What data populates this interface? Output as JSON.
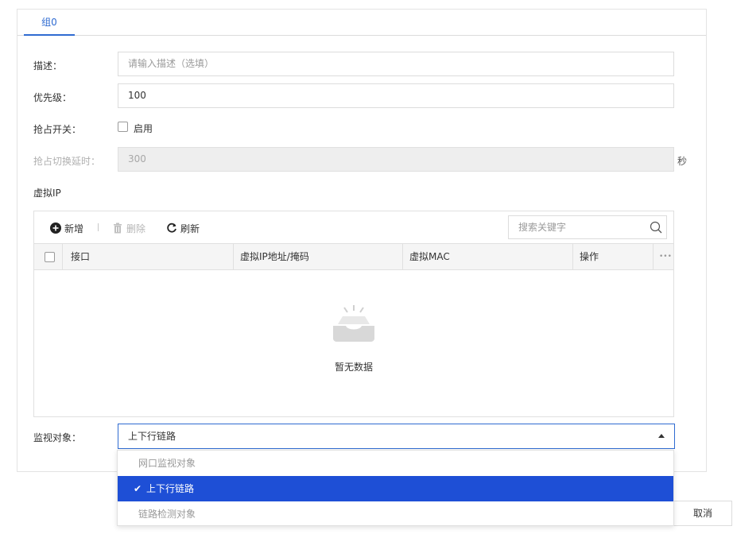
{
  "tab": {
    "label": "组0"
  },
  "form": {
    "description": {
      "label": "描述：",
      "placeholder": "请输入描述（选填）"
    },
    "priority": {
      "label": "优先级：",
      "value": "100"
    },
    "preempt": {
      "label": "抢占开关：",
      "checkbox_label": "启用"
    },
    "preempt_delay": {
      "label": "抢占切换延时：",
      "value": "300",
      "unit": "秒"
    }
  },
  "virtual_ip": {
    "title": "虚拟IP",
    "toolbar": {
      "add": "新增",
      "delete": "删除",
      "refresh": "刷新"
    },
    "search_placeholder": "搜索关键字",
    "columns": [
      "接口",
      "虚拟IP地址/掩码",
      "虚拟MAC",
      "操作"
    ],
    "more": "•••",
    "empty_text": "暂无数据"
  },
  "monitor": {
    "label": "监视对象：",
    "selected": "上下行链路",
    "options": [
      "网口监视对象",
      "上下行链路",
      "链路检测对象"
    ]
  },
  "footer": {
    "cancel": "取消"
  },
  "colors": {
    "accent": "#2f6bd1",
    "selected_bg": "#1e4fd6"
  }
}
